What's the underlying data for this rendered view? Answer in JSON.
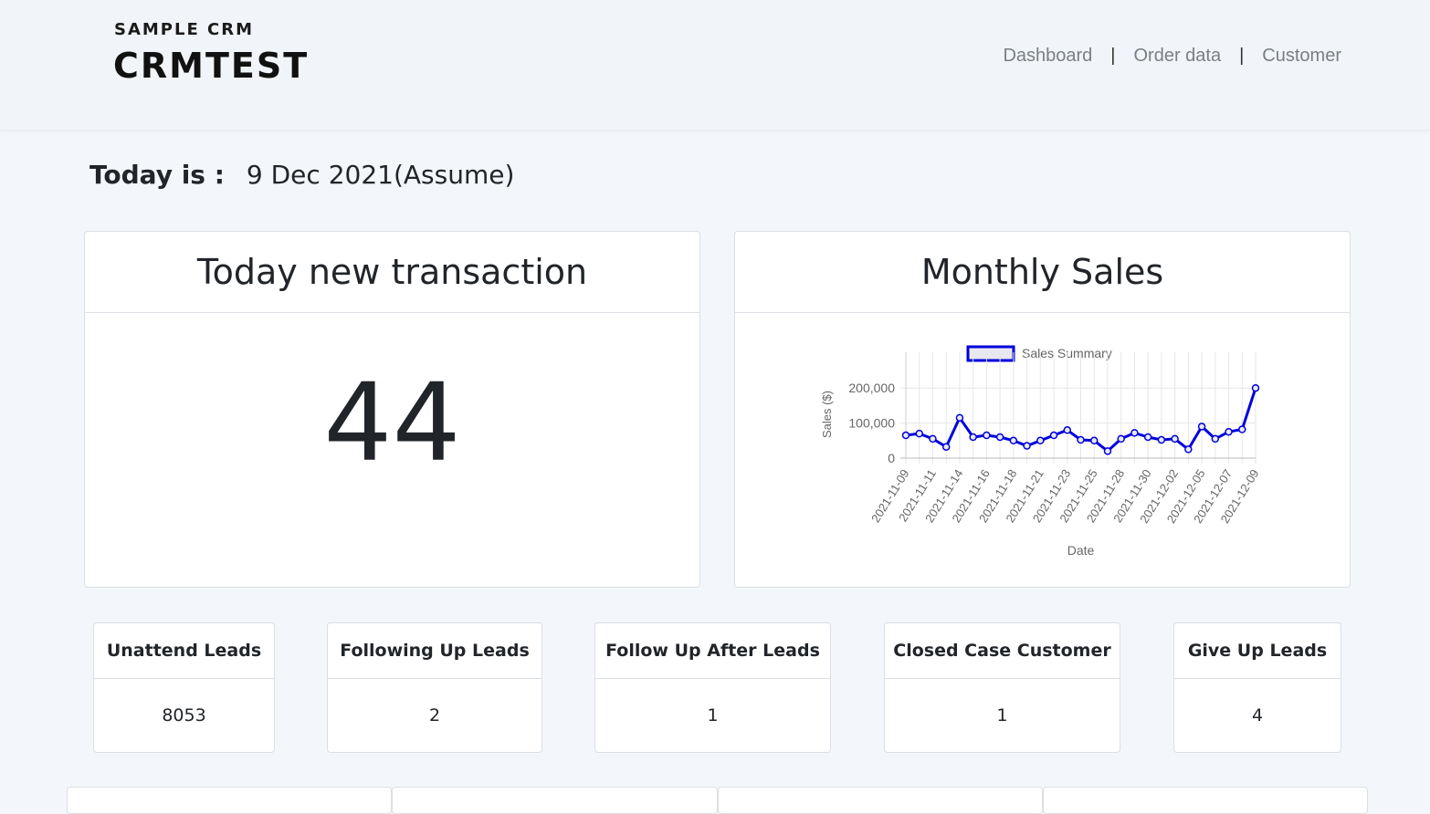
{
  "header": {
    "brand_sub": "SAMPLE CRM",
    "brand_main": "CRMTEST",
    "nav": [
      {
        "label": "Dashboard"
      },
      {
        "label": "Order data"
      },
      {
        "label": "Customer"
      }
    ],
    "nav_separator": "|"
  },
  "today": {
    "label": "Today is :",
    "value": "9 Dec 2021(Assume)"
  },
  "transaction_card": {
    "title": "Today new transaction",
    "value": "44"
  },
  "sales_card": {
    "title": "Monthly Sales"
  },
  "chart_data": {
    "type": "line",
    "title": "",
    "legend": [
      "Sales Summary"
    ],
    "legend_position": "top",
    "xlabel": "Date",
    "ylabel": "Sales ($)",
    "ylim": [
      0,
      250000
    ],
    "yticks": [
      0,
      100000,
      200000
    ],
    "ytick_labels": [
      "0",
      "100,000",
      "200,000"
    ],
    "grid": true,
    "color": "#0000dd",
    "x": [
      "2021-11-09",
      "2021-11-10",
      "2021-11-11",
      "2021-11-12",
      "2021-11-14",
      "2021-11-15",
      "2021-11-16",
      "2021-11-17",
      "2021-11-18",
      "2021-11-19",
      "2021-11-21",
      "2021-11-22",
      "2021-11-23",
      "2021-11-24",
      "2021-11-25",
      "2021-11-26",
      "2021-11-28",
      "2021-11-29",
      "2021-11-30",
      "2021-12-01",
      "2021-12-02",
      "2021-12-03",
      "2021-12-05",
      "2021-12-06",
      "2021-12-07",
      "2021-12-08",
      "2021-12-09"
    ],
    "xtick_labels": [
      "2021-11-09",
      "2021-11-11",
      "2021-11-14",
      "2021-11-16",
      "2021-11-18",
      "2021-11-21",
      "2021-11-23",
      "2021-11-25",
      "2021-11-28",
      "2021-11-30",
      "2021-12-02",
      "2021-12-05",
      "2021-12-07",
      "2021-12-09"
    ],
    "series": [
      {
        "name": "Sales Summary",
        "values": [
          65000,
          70000,
          55000,
          32000,
          115000,
          60000,
          65000,
          60000,
          50000,
          35000,
          50000,
          65000,
          80000,
          52000,
          50000,
          20000,
          55000,
          72000,
          60000,
          52000,
          55000,
          25000,
          90000,
          55000,
          75000,
          82000,
          200000
        ]
      }
    ]
  },
  "lead_cards": [
    {
      "title": "Unattend Leads",
      "value": "8053"
    },
    {
      "title": "Following Up Leads",
      "value": "2"
    },
    {
      "title": "Follow Up After Leads",
      "value": "1"
    },
    {
      "title": "Closed Case Customer",
      "value": "1"
    },
    {
      "title": "Give Up Leads",
      "value": "4"
    }
  ]
}
